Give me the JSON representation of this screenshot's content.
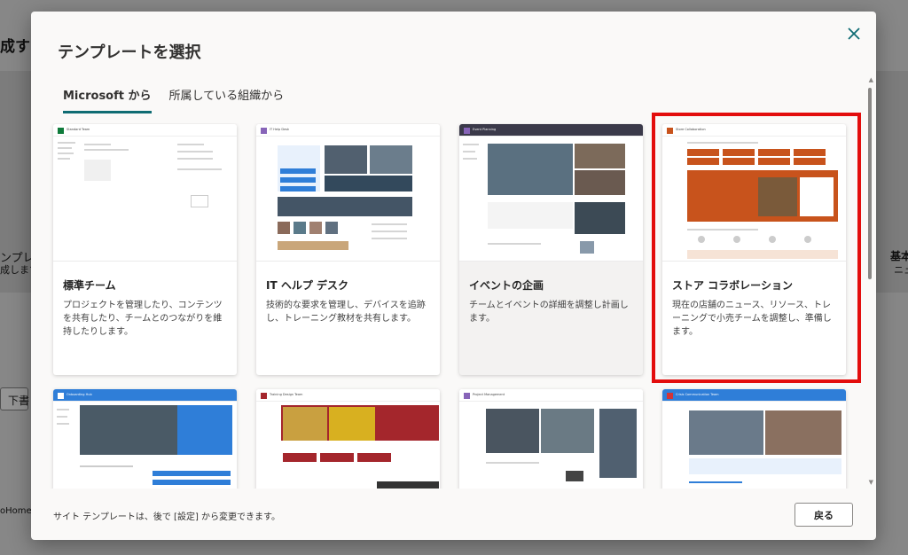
{
  "background": {
    "left_text_1": "成する",
    "left_text_2": "ンプレ",
    "left_text_3": "成します",
    "left_button": "下書",
    "left_text_4": "oHome.a",
    "right_text_1": "基本",
    "right_text_2": "ニュ"
  },
  "dialog": {
    "title": "テンプレートを選択",
    "close_label": "✕",
    "tabs": [
      {
        "label": "Microsoft から"
      },
      {
        "label": "所属している組織から"
      }
    ],
    "cards": [
      {
        "title": "標準チーム",
        "description": "プロジェクトを管理したり、コンテンツを共有したり、チームとのつながりを維持したりします。",
        "thumb_name": "Standard Team"
      },
      {
        "title": "IT ヘルプ デスク",
        "description": "技術的な要求を管理し、デバイスを追跡し、トレーニング教材を共有します。",
        "thumb_name": "IT Help Desk"
      },
      {
        "title": "イベントの企画",
        "description": "チームとイベントの詳細を調整し計画します。",
        "thumb_name": "Event Planning"
      },
      {
        "title": "ストア コラボレーション",
        "description": "現在の店舗のニュース、リソース、トレーニングで小売チームを調整し、準備します。",
        "thumb_name": "Store Collaboration"
      },
      {
        "title": "",
        "description": "",
        "thumb_name": "Onboarding Hub"
      },
      {
        "title": "",
        "description": "",
        "thumb_name": "Training Design Team"
      },
      {
        "title": "",
        "description": "",
        "thumb_name": "Project Management"
      },
      {
        "title": "",
        "description": "",
        "thumb_name": "Crisis Communication Team"
      }
    ],
    "footer_text": "サイト テンプレートは、後で [設定] から変更できます。",
    "back_button": "戻る"
  },
  "colors": {
    "accent": "#0f6c73",
    "highlight": "#e30d0d",
    "store_orange": "#c8531c",
    "training_red": "#a4262c",
    "it_blue": "#2f7ed8"
  }
}
